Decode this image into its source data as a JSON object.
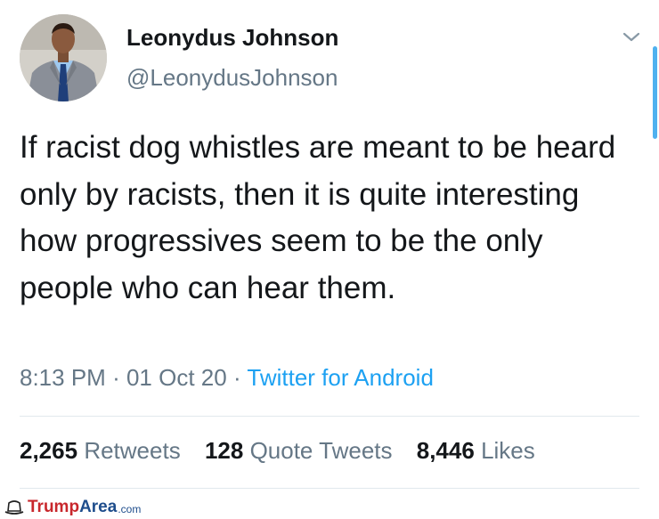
{
  "author": {
    "display_name": "Leonydus Johnson",
    "handle": "@LeonydusJohnson"
  },
  "tweet": {
    "text": "If racist dog whistles are meant to be heard only by racists, then it is quite interesting how progressives seem to be the only people who can hear them.",
    "time": "8:13 PM",
    "date": "01 Oct 20",
    "separator": "·",
    "source": "Twitter for Android"
  },
  "stats": {
    "retweets_count": "2,265",
    "retweets_label": "Retweets",
    "quote_count": "128",
    "quote_label": "Quote Tweets",
    "likes_count": "8,446",
    "likes_label": "Likes"
  },
  "watermark": {
    "brand_part1": "Trump",
    "brand_part2": "Area",
    "brand_suffix": ".com"
  },
  "colors": {
    "accent": "#1da1f2",
    "secondary_text": "#657786",
    "primary_text": "#14171a",
    "divider": "#e1e8ed"
  },
  "icons": {
    "chevron": "chevron-down-icon",
    "watermark": "hat-icon"
  }
}
